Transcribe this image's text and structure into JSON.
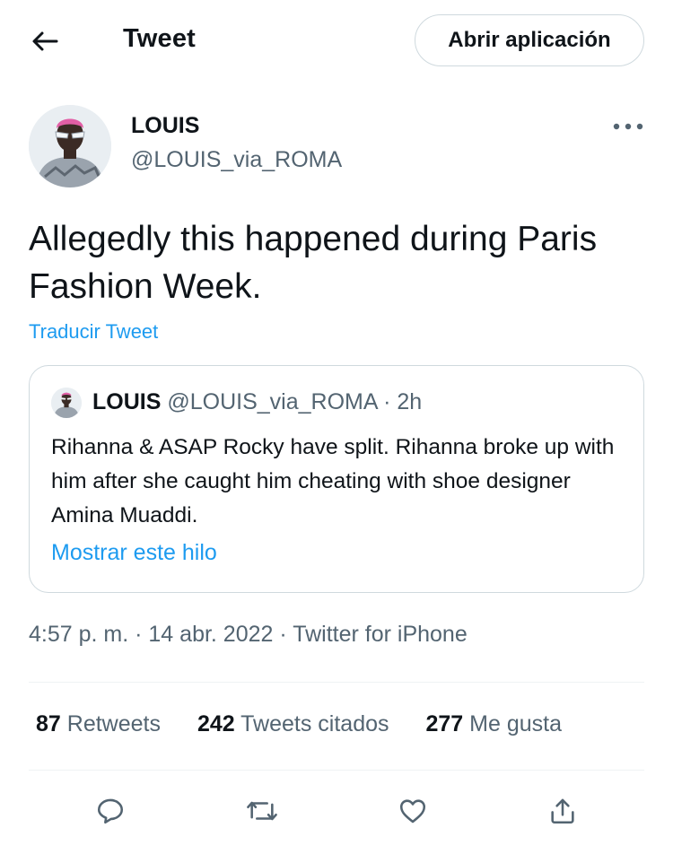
{
  "header": {
    "back_icon": "arrow-left-icon",
    "title": "Tweet",
    "open_app_label": "Abrir aplicación"
  },
  "author": {
    "name": "LOUIS",
    "handle": "@LOUIS_via_ROMA",
    "more_icon": "more-horizontal-icon"
  },
  "tweet": {
    "text": "Allegedly this happened during Paris Fashion Week.",
    "translate_label": "Traducir Tweet"
  },
  "quote": {
    "name": "LOUIS",
    "handle": "@LOUIS_via_ROMA",
    "separator": "·",
    "time": "2h",
    "text": "Rihanna & ASAP Rocky have split. Rihanna broke up with him after she caught him cheating with shoe designer Amina Muaddi.",
    "show_thread_label": "Mostrar este hilo"
  },
  "meta": {
    "time": "4:57 p. m.",
    "date": "14 abr. 2022",
    "source": "Twitter for iPhone",
    "separator": "·"
  },
  "stats": {
    "retweets_count": "87",
    "retweets_label": "Retweets",
    "quotes_count": "242",
    "quotes_label": "Tweets citados",
    "likes_count": "277",
    "likes_label": "Me gusta"
  },
  "actions": {
    "reply_icon": "reply-icon",
    "retweet_icon": "retweet-icon",
    "like_icon": "heart-icon",
    "share_icon": "share-icon"
  },
  "colors": {
    "text": "#0f1419",
    "secondary": "#536471",
    "link": "#1d9bf0",
    "border": "#cfd9de"
  }
}
